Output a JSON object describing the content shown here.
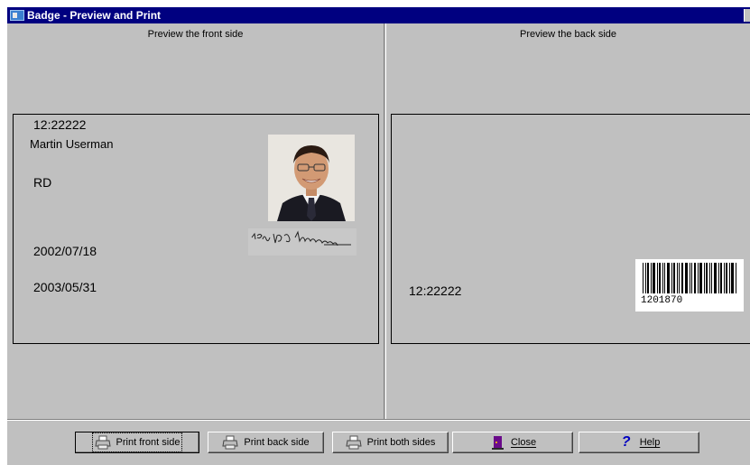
{
  "window": {
    "title": "Badge - Preview and Print"
  },
  "front": {
    "label": "Preview the front side",
    "id": "12:22222",
    "name": "Martin Userman",
    "dept": "RD",
    "date1": "2002/07/18",
    "date2": "2003/05/31"
  },
  "back": {
    "label": "Preview the back side",
    "id": "12:22222",
    "barcode_number": "1201870"
  },
  "buttons": {
    "print_front": "Print front side",
    "print_back": "Print back side",
    "print_both": "Print both sides",
    "close": "Close",
    "help": "Help"
  },
  "icons": {
    "app": "badge-app-icon",
    "printer": "printer-icon",
    "close": "exit-door-icon",
    "help": "question-mark-icon"
  },
  "colors": {
    "titlebar": "#000080",
    "face": "#c0c0c0",
    "help_icon": "#0000c0",
    "close_icon": "#6a0a8a"
  }
}
